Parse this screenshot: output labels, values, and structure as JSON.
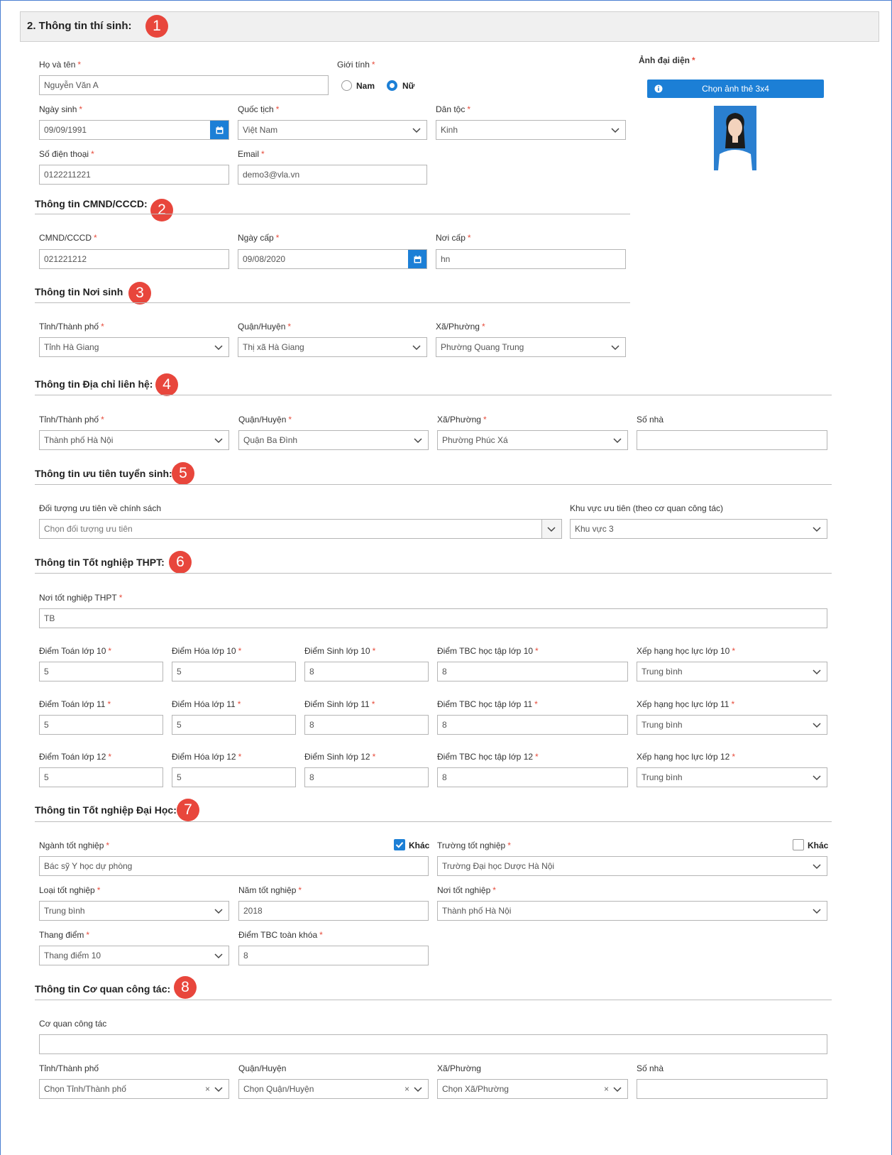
{
  "header": {
    "title": "2. Thông tin thí sinh:",
    "badge": "1"
  },
  "personal": {
    "name_label": "Họ và tên",
    "name_value": "Nguyễn Văn A",
    "gender_label": "Giới tính",
    "male_label": "Nam",
    "female_label": "Nữ",
    "gender_selected": "Nữ",
    "dob_label": "Ngày sinh",
    "dob_value": "09/09/1991",
    "nationality_label": "Quốc tịch",
    "nationality_value": "Việt Nam",
    "ethnicity_label": "Dân tộc",
    "ethnicity_value": "Kinh",
    "phone_label": "Số điện thoại",
    "phone_value": "0122211221",
    "email_label": "Email",
    "email_value": "demo3@vla.vn",
    "avatar_label": "Ảnh đại diện",
    "photo_button": "Chọn ảnh thẻ 3x4"
  },
  "id_section": {
    "title": "Thông tin CMND/CCCD:",
    "badge": "2",
    "id_label": "CMND/CCCD",
    "id_value": "021221212",
    "issue_date_label": "Ngày cấp",
    "issue_date_value": "09/08/2020",
    "issue_place_label": "Nơi cấp",
    "issue_place_value": "hn"
  },
  "birthplace": {
    "title": "Thông tin Nơi sinh",
    "badge": "3",
    "province_label": "Tỉnh/Thành phố",
    "province_value": "Tỉnh Hà Giang",
    "district_label": "Quận/Huyện",
    "district_value": "Thị xã Hà Giang",
    "ward_label": "Xã/Phường",
    "ward_value": "Phường Quang Trung"
  },
  "contact": {
    "title": "Thông tin Địa chỉ liên hệ:",
    "badge": "4",
    "province_label": "Tỉnh/Thành phố",
    "province_value": "Thành phố Hà Nội",
    "district_label": "Quận/Huyện",
    "district_value": "Quận Ba Đình",
    "ward_label": "Xã/Phường",
    "ward_value": "Phường Phúc Xá",
    "house_label": "Số nhà",
    "house_value": ""
  },
  "priority": {
    "title": "Thông tin ưu tiên tuyển sinh:",
    "badge": "5",
    "policy_label": "Đối tượng ưu tiên về chính sách",
    "policy_placeholder": "Chọn đối tượng ưu tiên",
    "area_label": "Khu vực ưu tiên (theo cơ quan công tác)",
    "area_value": "Khu vực 3"
  },
  "highschool": {
    "title": "Thông tin Tốt nghiệp THPT:",
    "badge": "6",
    "place_label": "Nơi tốt nghiệp THPT",
    "place_value": "TB",
    "rows": [
      {
        "math_label": "Điểm Toán lớp 10",
        "math": "5",
        "chem_label": "Điểm Hóa lớp 10",
        "chem": "5",
        "bio_label": "Điểm Sinh lớp 10",
        "bio": "8",
        "avg_label": "Điểm TBC học tập lớp 10",
        "avg": "8",
        "rank_label": "Xếp hạng học lực lớp 10",
        "rank": "Trung bình"
      },
      {
        "math_label": "Điểm Toán lớp 11",
        "math": "5",
        "chem_label": "Điểm Hóa lớp 11",
        "chem": "5",
        "bio_label": "Điểm Sinh lớp 11",
        "bio": "8",
        "avg_label": "Điểm TBC học tập lớp 11",
        "avg": "8",
        "rank_label": "Xếp hạng học lực lớp 11",
        "rank": "Trung bình"
      },
      {
        "math_label": "Điểm Toán lớp 12",
        "math": "5",
        "chem_label": "Điểm Hóa lớp 12",
        "chem": "5",
        "bio_label": "Điểm Sinh lớp 12",
        "bio": "8",
        "avg_label": "Điểm TBC học tập lớp 12",
        "avg": "8",
        "rank_label": "Xếp hạng học lực lớp 12",
        "rank": "Trung bình"
      }
    ]
  },
  "university": {
    "title": "Thông tin Tốt nghiệp Đại Học:",
    "badge": "7",
    "major_label": "Ngành tốt nghiệp",
    "major_value": "Bác sỹ Y học dự phòng",
    "major_other_label": "Khác",
    "major_other_checked": true,
    "school_label": "Trường tốt nghiệp",
    "school_value": "Trường Đại học Dược Hà Nội",
    "school_other_label": "Khác",
    "school_other_checked": false,
    "type_label": "Loại tốt nghiệp",
    "type_value": "Trung bình",
    "year_label": "Năm tốt nghiệp",
    "year_value": "2018",
    "place_label": "Nơi tốt nghiệp",
    "place_value": "Thành phố Hà Nội",
    "scale_label": "Thang điểm",
    "scale_value": "Thang điểm 10",
    "gpa_label": "Điểm TBC toàn khóa",
    "gpa_value": "8"
  },
  "work": {
    "title": "Thông tin Cơ quan công tác:",
    "badge": "8",
    "org_label": "Cơ quan công tác",
    "org_value": "",
    "province_label": "Tỉnh/Thành phố",
    "province_placeholder": "Chọn Tỉnh/Thành phố",
    "district_label": "Quận/Huyện",
    "district_placeholder": "Chọn Quận/Huyện",
    "ward_label": "Xã/Phường",
    "ward_placeholder": "Chọn Xã/Phường",
    "house_label": "Số nhà",
    "house_value": ""
  },
  "colors": {
    "accent": "#1c7fd6",
    "badge": "#e8463c",
    "required": "#e74c3c"
  }
}
